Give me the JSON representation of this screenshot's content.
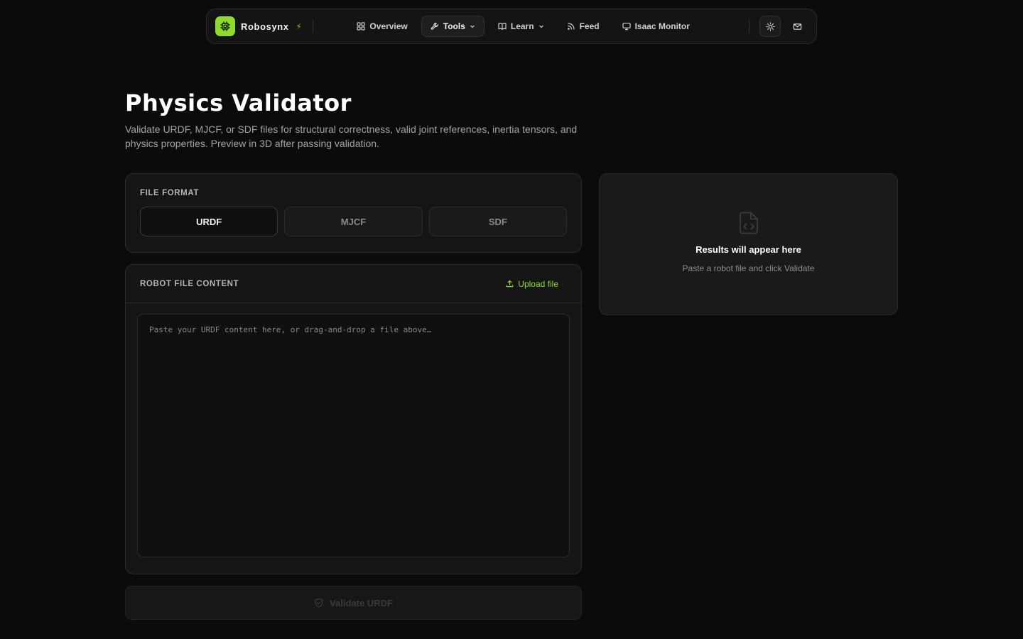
{
  "nav": {
    "brand": "Robosynx",
    "brand_bolt": "⚡",
    "links": [
      {
        "label": "Overview",
        "icon": "grid-icon"
      },
      {
        "label": "Tools",
        "icon": "wrench-icon",
        "active": true,
        "dropdown": true
      },
      {
        "label": "Learn",
        "icon": "book-icon",
        "dropdown": true
      },
      {
        "label": "Feed",
        "icon": "rss-icon"
      },
      {
        "label": "Isaac Monitor",
        "icon": "monitor-icon"
      }
    ],
    "theme_icon": "sun-icon",
    "mail_icon": "mail-icon"
  },
  "page": {
    "title": "Physics Validator",
    "description": "Validate URDF, MJCF, or SDF files for structural correctness, valid joint references, inertia tensors, and physics properties. Preview in 3D after passing validation."
  },
  "format": {
    "label": "FILE FORMAT",
    "options": [
      "URDF",
      "MJCF",
      "SDF"
    ],
    "selected": "URDF"
  },
  "content": {
    "label": "ROBOT FILE CONTENT",
    "upload_label": "Upload file",
    "editor_value": "",
    "editor_placeholder": "Paste your URDF content here, or drag-and-drop a file above…"
  },
  "validate": {
    "label": "Validate URDF",
    "enabled": false
  },
  "results": {
    "title": "Results will appear here",
    "subtitle": "Paste a robot file and click Validate"
  },
  "colors": {
    "accent": "#8ddc2c",
    "background": "#0b0b0b",
    "panel": "#151515"
  }
}
